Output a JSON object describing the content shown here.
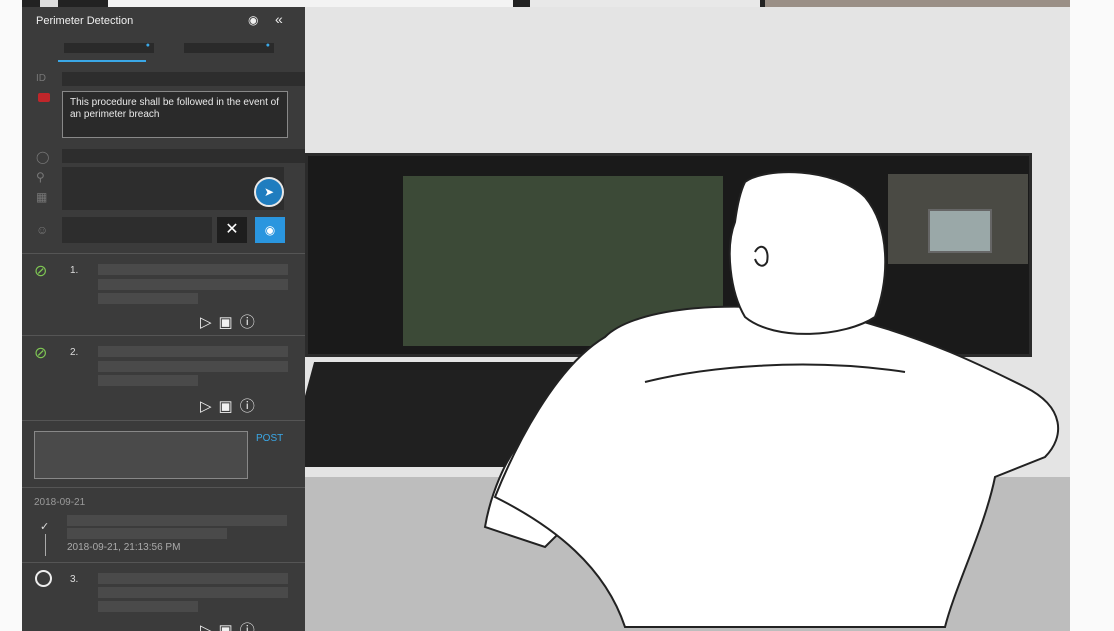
{
  "panel": {
    "title": "Perimeter Detection",
    "id_label": "ID",
    "description": "This procedure shall be followed in the event of an perimeter breach"
  },
  "steps": [
    {
      "number": "1.",
      "status": "done",
      "actions": [
        "play-icon",
        "media-icon",
        "info-icon"
      ]
    },
    {
      "number": "2.",
      "status": "done",
      "actions": [
        "play-icon",
        "media-icon",
        "info-icon"
      ]
    },
    {
      "number": "3.",
      "status": "pending",
      "actions": [
        "play-icon",
        "media-icon",
        "info-icon"
      ]
    }
  ],
  "post": {
    "label": "POST"
  },
  "log": {
    "date": "2018-09-21",
    "timestamp": "2018-09-21, 21:13:56 PM"
  },
  "colors": {
    "panel_bg": "#3b3b3b",
    "accent": "#3aa7e6",
    "check": "#7ec653",
    "alert": "#c0262a"
  }
}
